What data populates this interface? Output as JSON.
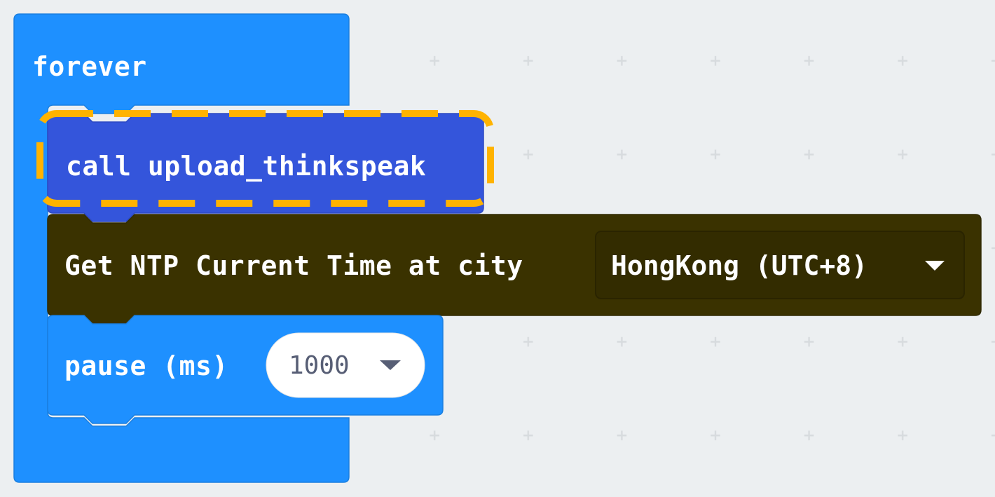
{
  "workspace": {
    "background": "#eceff1",
    "grid_color": "#d7dbde"
  },
  "blocks": {
    "forever": {
      "label": "forever",
      "color": "#1e90ff"
    },
    "call": {
      "label": "call upload_thinkspeak",
      "color": "#3455db",
      "highlight_color": "#ffb300"
    },
    "ntp": {
      "label": "Get NTP Current Time at city",
      "color": "#3a3200",
      "city_dropdown": {
        "value": "HongKong (UTC+8)",
        "icon": "triangle-down-icon"
      }
    },
    "pause": {
      "label": "pause (ms)",
      "color": "#1e90ff",
      "duration_dropdown": {
        "value": "1000",
        "icon": "triangle-down-icon"
      }
    }
  }
}
